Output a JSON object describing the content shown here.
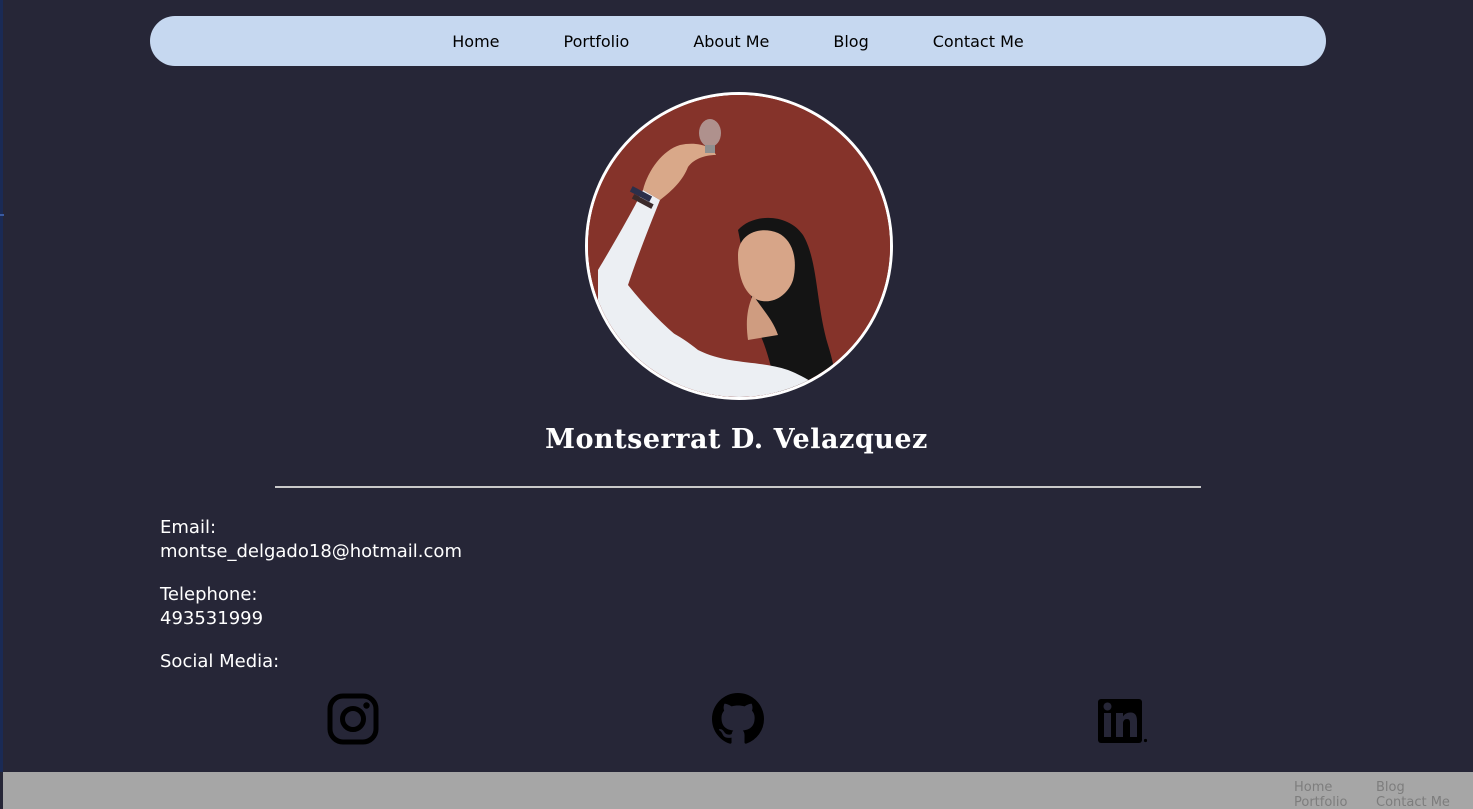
{
  "nav": {
    "items": [
      {
        "label": "Home"
      },
      {
        "label": "Portfolio"
      },
      {
        "label": "About Me"
      },
      {
        "label": "Blog"
      },
      {
        "label": "Contact Me"
      }
    ]
  },
  "profile": {
    "photo_icon": "profile-photo",
    "name": "Montserrat D. Velazquez"
  },
  "contact": {
    "email_label": "Email:",
    "email_value": "montse_delgado18@hotmail.com",
    "phone_label": "Telephone:",
    "phone_value": "493531999",
    "social_label": "Social Media:"
  },
  "social": {
    "icons": [
      "instagram-icon",
      "github-icon",
      "linkedin-icon"
    ]
  },
  "footer": {
    "links": [
      {
        "label": "Home"
      },
      {
        "label": "Blog"
      },
      {
        "label": "Portfolio"
      },
      {
        "label": "Contact Me"
      }
    ]
  },
  "colors": {
    "background": "#262637",
    "navbar": "#c6d8f0",
    "footer": "#a6a6a6",
    "text": "#ffffff"
  }
}
